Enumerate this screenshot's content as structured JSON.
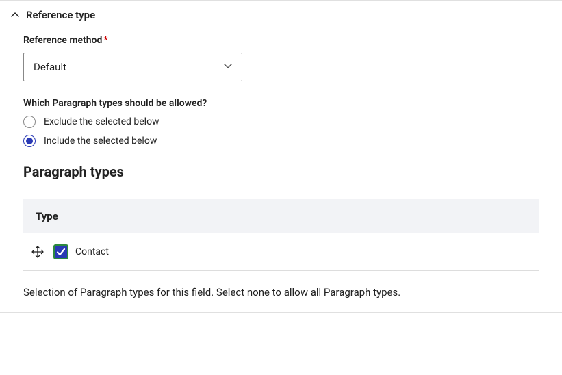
{
  "section": {
    "title": "Reference type"
  },
  "reference_method": {
    "label": "Reference method",
    "required": "*",
    "value": "Default"
  },
  "allowed_types": {
    "label": "Which Paragraph types should be allowed?",
    "options": {
      "exclude": "Exclude the selected below",
      "include": "Include the selected below"
    }
  },
  "paragraph_types": {
    "heading": "Paragraph types",
    "column_header": "Type",
    "items": [
      {
        "label": "Contact",
        "checked": true
      }
    ]
  },
  "help_text": "Selection of Paragraph types for this field. Select none to allow all Paragraph types."
}
